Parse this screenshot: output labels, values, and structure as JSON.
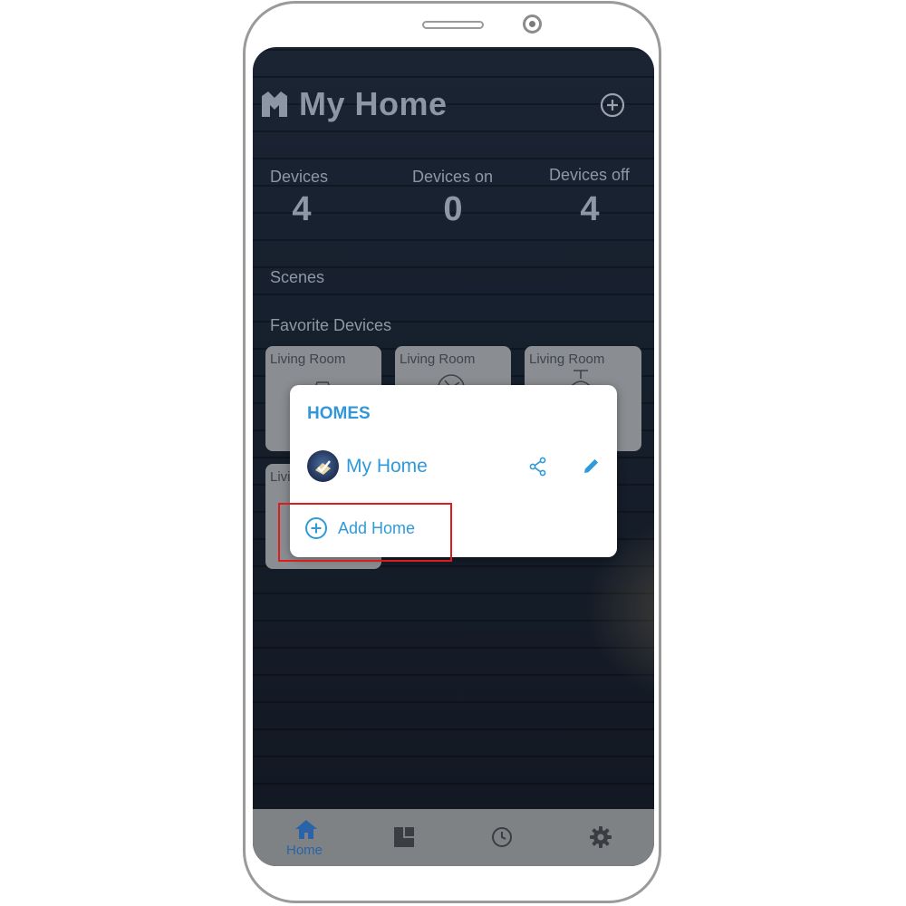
{
  "app": {
    "title": "My Home"
  },
  "stats": [
    {
      "label": "Devices",
      "value": "4"
    },
    {
      "label": "Devices on",
      "value": "0"
    },
    {
      "label": "Devices off",
      "value": "4"
    }
  ],
  "sections": {
    "scenes": "Scenes",
    "favorites": "Favorite Devices"
  },
  "favorite_devices": [
    {
      "room": "Living Room",
      "icon": "lamp-icon"
    },
    {
      "room": "Living Room",
      "icon": "fan-icon"
    },
    {
      "room": "Living Room",
      "icon": "ceiling-light-icon"
    },
    {
      "room": "Livi",
      "icon": "light-icon"
    }
  ],
  "homes_dialog": {
    "title": "HOMES",
    "homes": [
      {
        "name": "My Home"
      }
    ],
    "add_label": "Add Home"
  },
  "bottom_nav": {
    "items": [
      {
        "label": "Home",
        "icon": "home-icon",
        "active": true
      },
      {
        "label": "",
        "icon": "rooms-icon"
      },
      {
        "label": "",
        "icon": "clock-icon"
      },
      {
        "label": "",
        "icon": "gear-icon"
      }
    ]
  },
  "colors": {
    "accent": "#2f9ad8",
    "highlight": "#e01b1b",
    "nav_active": "#2a63a8"
  }
}
